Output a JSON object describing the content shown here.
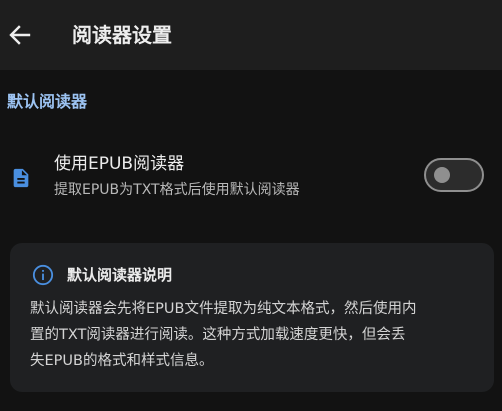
{
  "appbar": {
    "back_icon": "arrow-left-icon",
    "title": "阅读器设置"
  },
  "section": {
    "header": "默认阅读器"
  },
  "setting": {
    "icon": "document-icon",
    "title": "使用EPUB阅读器",
    "subtitle": "提取EPUB为TXT格式后使用默认阅读器",
    "toggle_on": false
  },
  "info_card": {
    "icon": "info-icon",
    "title": "默认阅读器说明",
    "body_lines": [
      "默认阅读器会先将EPUB文件提取为纯文本格式，然后使用内",
      "置的TXT阅读器进行阅读。这种方式加载速度更快，但会丢",
      "失EPUB的格式和样式信息。"
    ]
  },
  "colors": {
    "background": "#121212",
    "appbar": "#1e1e1e",
    "accent": "#9cc3f2",
    "icon_blue": "#4a8fe0",
    "card": "#1f2022",
    "toggle_outline": "#8f8f8f"
  }
}
